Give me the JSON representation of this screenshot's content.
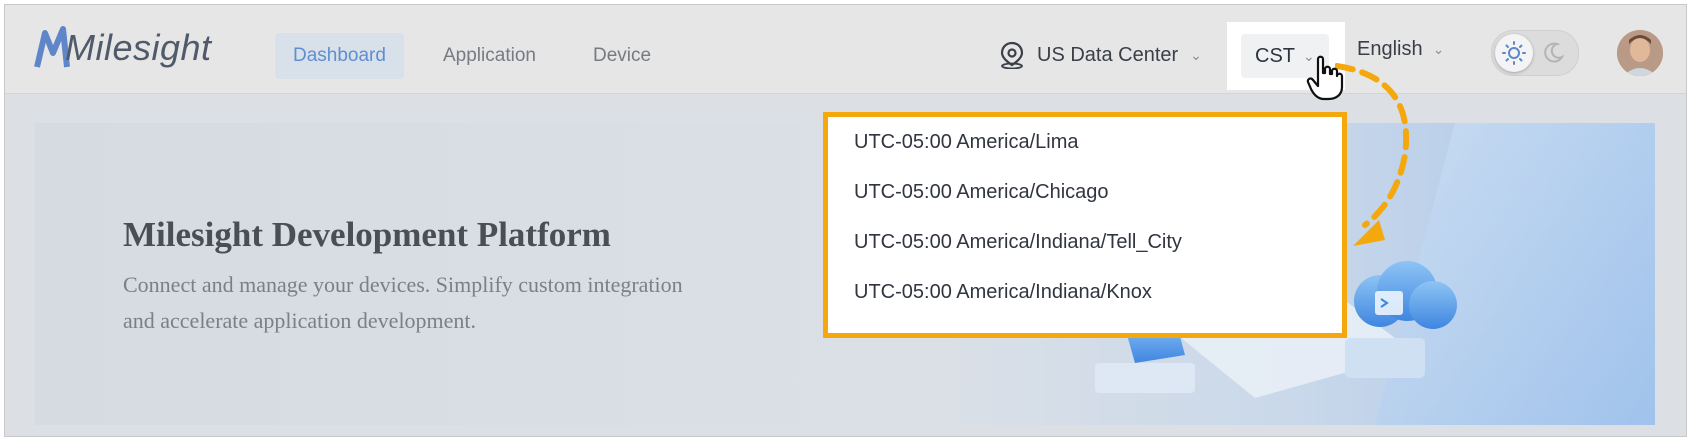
{
  "header": {
    "logo_text": "Milesight",
    "nav": [
      {
        "label": "Dashboard",
        "active": true
      },
      {
        "label": "Application",
        "active": false
      },
      {
        "label": "Device",
        "active": false
      }
    ],
    "region": {
      "label": "US Data Center",
      "icon": "location-pin-icon"
    },
    "timezone": {
      "label": "CST"
    },
    "language": {
      "label": "English"
    },
    "theme": {
      "light_icon": "sun-icon",
      "dark_icon": "moon-icon",
      "selected": "light"
    }
  },
  "hero": {
    "title": "Milesight Development Platform",
    "subtitle": "Connect and manage your devices. Simplify custom integration and accelerate application development."
  },
  "timezone_dropdown": {
    "options": [
      "UTC-05:00 America/Lima",
      "UTC-05:00 America/Chicago",
      "UTC-05:00 America/Indiana/Tell_City",
      "UTC-05:00 America/Indiana/Knox"
    ]
  },
  "colors": {
    "accent": "#5f8fd0",
    "highlight": "#f5a70e"
  }
}
